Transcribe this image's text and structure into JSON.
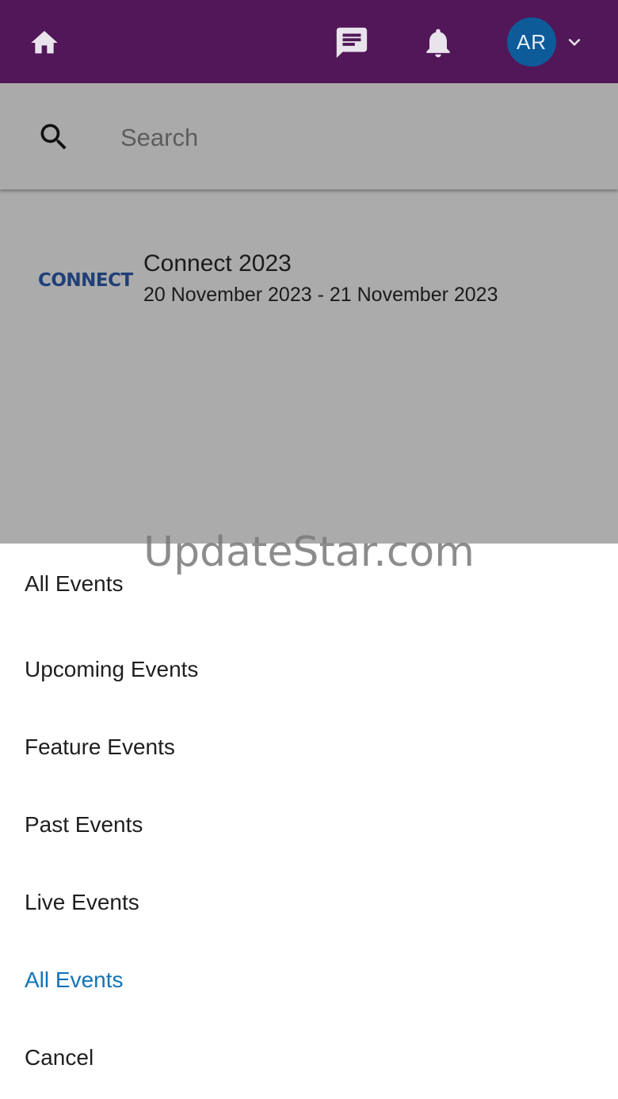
{
  "header": {
    "avatar_initials": "AR",
    "icons": [
      "home-icon",
      "chat-icon",
      "bell-icon",
      "chevron-down-icon"
    ],
    "background_color": "#511758",
    "avatar_color": "#0e5b9a"
  },
  "search": {
    "placeholder": "Search",
    "value": ""
  },
  "events": [
    {
      "logo_text": "CONNECT",
      "title": "Connect 2023",
      "dates": "20 November 2023 - 21 November 2023"
    }
  ],
  "filter_sheet": {
    "options": [
      {
        "label": "All Events",
        "selected": false
      },
      {
        "label": "Upcoming Events",
        "selected": false
      },
      {
        "label": "Feature Events",
        "selected": false
      },
      {
        "label": "Past Events",
        "selected": false
      },
      {
        "label": "Live Events",
        "selected": false
      },
      {
        "label": "All Events",
        "selected": true
      },
      {
        "label": "Cancel",
        "selected": false
      }
    ],
    "selected_color": "#1273b8"
  },
  "watermark": "UpdateStar.com"
}
